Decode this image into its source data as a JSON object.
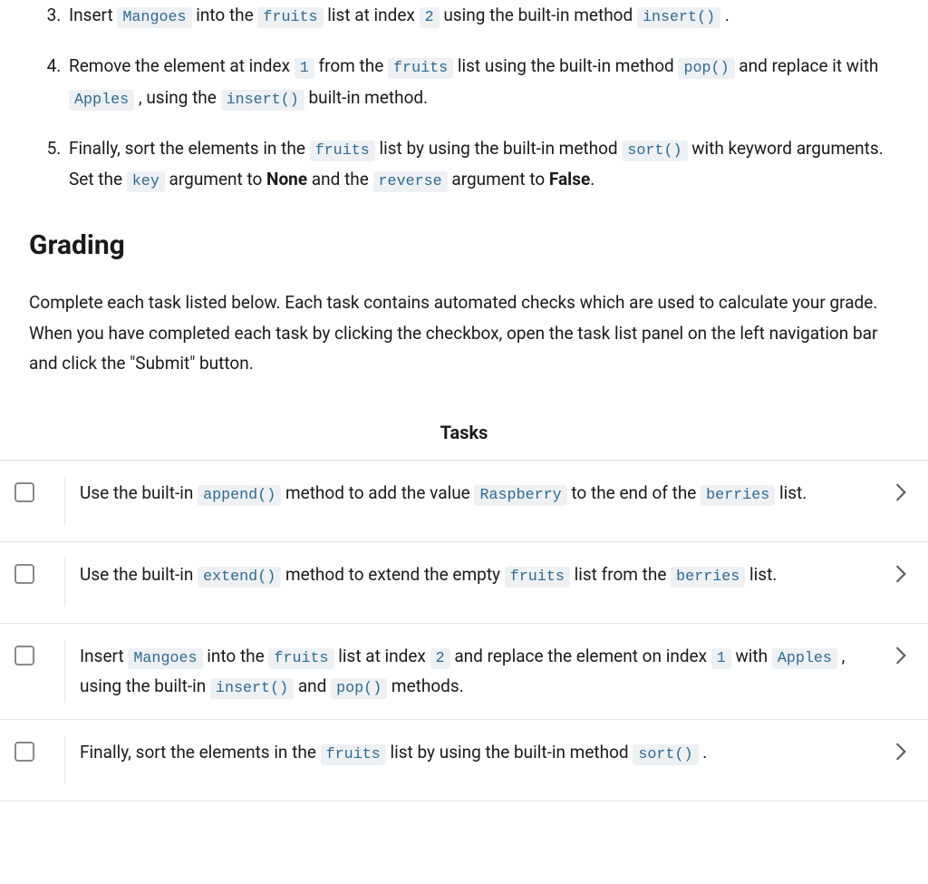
{
  "instructions": [
    {
      "number": "3",
      "parts": [
        {
          "text": "Insert "
        },
        {
          "code": "Mangoes"
        },
        {
          "text": " into the "
        },
        {
          "code": "fruits"
        },
        {
          "text": " list at index "
        },
        {
          "code": "2"
        },
        {
          "text": " using the built-in method "
        },
        {
          "code": "insert()"
        },
        {
          "text": " ."
        }
      ]
    },
    {
      "number": "4",
      "parts": [
        {
          "text": "Remove the element at index "
        },
        {
          "code": "1"
        },
        {
          "text": " from the "
        },
        {
          "code": "fruits"
        },
        {
          "text": " list using the built-in method "
        },
        {
          "code": "pop()"
        },
        {
          "text": " and replace it with "
        },
        {
          "code": "Apples"
        },
        {
          "text": " , using the "
        },
        {
          "code": "insert()"
        },
        {
          "text": " built-in method."
        }
      ]
    },
    {
      "number": "5",
      "parts": [
        {
          "text": "Finally, sort the elements in the "
        },
        {
          "code": "fruits"
        },
        {
          "text": " list by using the built-in method "
        },
        {
          "code": "sort()"
        },
        {
          "text": " with keyword arguments. Set the "
        },
        {
          "code": "key"
        },
        {
          "text": " argument to "
        },
        {
          "bold": "None"
        },
        {
          "text": " and the "
        },
        {
          "code": "reverse"
        },
        {
          "text": " argument to "
        },
        {
          "bold": "False"
        },
        {
          "text": "."
        }
      ]
    }
  ],
  "grading": {
    "heading": "Grading",
    "description": "Complete each task listed below. Each task contains automated checks which are used to calculate your grade. When you have completed each task by clicking the checkbox, open the task list panel on the left navigation bar and click the \"Submit\" button."
  },
  "tasks_header": "Tasks",
  "tasks": [
    {
      "parts": [
        {
          "text": "Use the built-in "
        },
        {
          "code": "append()"
        },
        {
          "text": " method to add the value "
        },
        {
          "code": "Raspberry"
        },
        {
          "text": " to the end of the "
        },
        {
          "code": "berries"
        },
        {
          "text": " list."
        }
      ]
    },
    {
      "parts": [
        {
          "text": "Use the built-in "
        },
        {
          "code": "extend()"
        },
        {
          "text": " method to extend the empty "
        },
        {
          "code": "fruits"
        },
        {
          "text": " list from the "
        },
        {
          "code": "berries"
        },
        {
          "text": " list."
        }
      ]
    },
    {
      "parts": [
        {
          "text": "Insert "
        },
        {
          "code": "Mangoes"
        },
        {
          "text": " into the "
        },
        {
          "code": "fruits"
        },
        {
          "text": " list at index "
        },
        {
          "code": "2"
        },
        {
          "text": " and replace the element on index "
        },
        {
          "code": "1"
        },
        {
          "text": " with "
        },
        {
          "code": "Apples"
        },
        {
          "text": " , using the built-in "
        },
        {
          "code": "insert()"
        },
        {
          "text": " and "
        },
        {
          "code": "pop()"
        },
        {
          "text": " methods."
        }
      ]
    },
    {
      "parts": [
        {
          "text": "Finally, sort the elements in the "
        },
        {
          "code": "fruits"
        },
        {
          "text": " list by using the built-in method "
        },
        {
          "code": "sort()"
        },
        {
          "text": " ."
        }
      ]
    }
  ]
}
